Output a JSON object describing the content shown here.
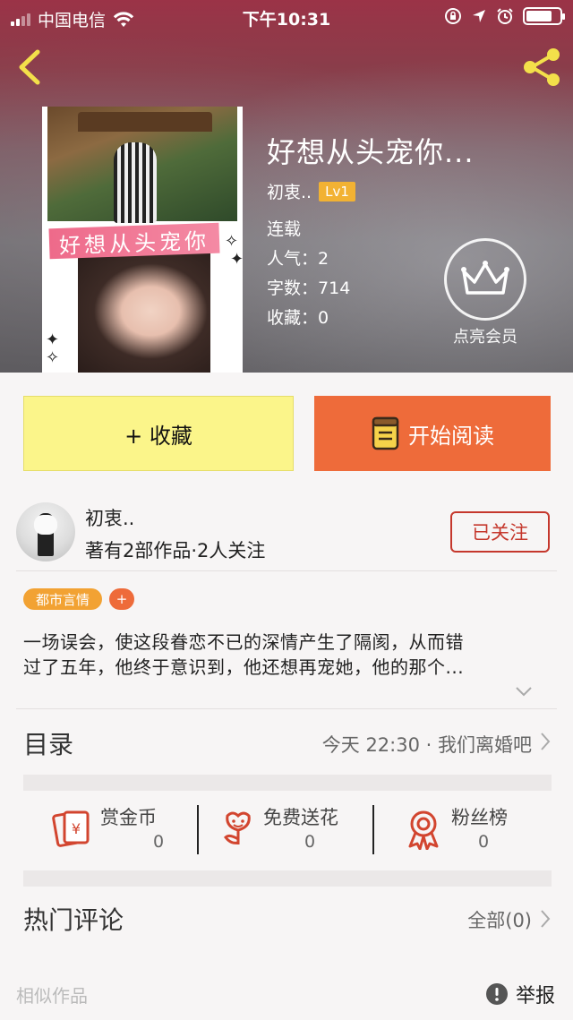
{
  "status_bar": {
    "carrier": "中国电信",
    "time": "下午10:31"
  },
  "book": {
    "title": "好想从头宠你...",
    "cover_banner_text": "好想从头宠你",
    "author": "初衷..",
    "level": "Lv1",
    "status": "连载",
    "popularity_label": "人气：",
    "popularity_value": "2",
    "words_label": "字数：",
    "words_value": "714",
    "favorites_label": "收藏：",
    "favorites_value": "0"
  },
  "vip": {
    "label": "点亮会员"
  },
  "actions": {
    "collect_label": "+ 收藏",
    "read_label": "开始阅读"
  },
  "author_card": {
    "name": "初衷..",
    "stats": "著有2部作品·2人关注",
    "follow_label": "已关注"
  },
  "tags": {
    "genre": "都市言情",
    "add": "+"
  },
  "synopsis": {
    "line1": "一场误会，使这段眷恋不已的深情产生了隔阂，从而错",
    "line2": "过了五年，他终于意识到，他还想再宠她，他的那个..."
  },
  "toc": {
    "title": "目录",
    "latest": "今天 22:30 · 我们离婚吧"
  },
  "stats": [
    {
      "name": "赏金币",
      "value": "0"
    },
    {
      "name": "免费送花",
      "value": "0"
    },
    {
      "name": "粉丝榜",
      "value": "0"
    }
  ],
  "comments": {
    "title": "热门评论",
    "all_label": "全部(0)"
  },
  "footer": {
    "similar_label": "相似作品",
    "report_label": "举报"
  },
  "colors": {
    "accent_orange": "#ee6b3a",
    "collect_yellow": "#fbf58a",
    "follow_red": "#c5372c",
    "tag_orange": "#f2a233",
    "icon_red": "#d2452f"
  }
}
